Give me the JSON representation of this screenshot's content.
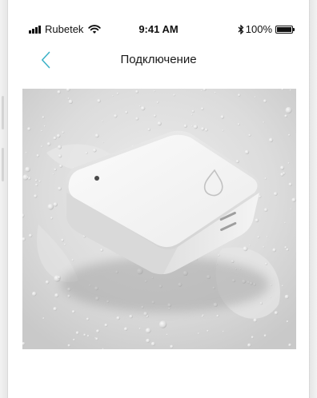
{
  "status_bar": {
    "carrier": "Rubetek",
    "time": "9:41 AM",
    "battery_percent": "100%",
    "battery_level": 1.0,
    "icons": [
      "signal-icon",
      "wifi-icon",
      "bluetooth-icon",
      "battery-icon"
    ]
  },
  "nav": {
    "title": "Подключение",
    "back_icon": "chevron-left-icon",
    "accent_color": "#3fb3c8"
  },
  "hero": {
    "image": "water-leak-sensor-photo",
    "device_icon": "water-drop-icon"
  }
}
